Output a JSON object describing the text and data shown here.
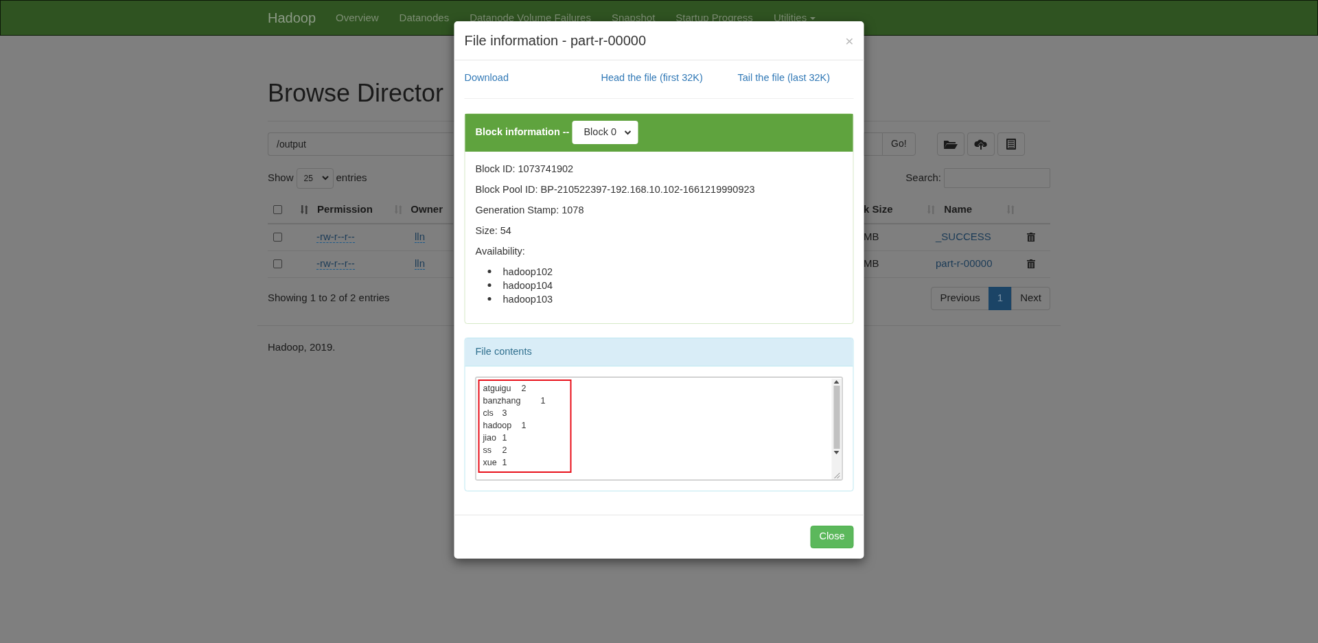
{
  "navbar": {
    "brand": "Hadoop",
    "items": [
      {
        "label": "Overview",
        "dropdown": false
      },
      {
        "label": "Datanodes",
        "dropdown": false
      },
      {
        "label": "Datanode Volume Failures",
        "dropdown": false
      },
      {
        "label": "Snapshot",
        "dropdown": false
      },
      {
        "label": "Startup Progress",
        "dropdown": false
      },
      {
        "label": "Utilities",
        "dropdown": true
      }
    ]
  },
  "browser": {
    "title": "Browse Director",
    "path": "/output",
    "go_label": "Go!",
    "show_label": "Show",
    "page_size": "25",
    "entries_label": "entries",
    "search_label": "Search:",
    "select_all_checked": false,
    "columns_left": [
      "Permission",
      "Owner"
    ],
    "columns_right": [
      "k Size",
      "Name"
    ],
    "rows": [
      {
        "checked": false,
        "permission": "-rw-r--r--",
        "owner": "lln",
        "size": "MB",
        "name": "_SUCCESS"
      },
      {
        "checked": false,
        "permission": "-rw-r--r--",
        "owner": "lln",
        "size": "MB",
        "name": "part-r-00000"
      }
    ],
    "info": "Showing 1 to 2 of 2 entries",
    "pagination": [
      {
        "label": "Previous",
        "selected": false
      },
      {
        "label": "1",
        "selected": true
      },
      {
        "label": "Next",
        "selected": false
      }
    ],
    "footer": "Hadoop, 2019."
  },
  "modal": {
    "title": "File information - part-r-00000",
    "close": "×",
    "links": [
      "Download",
      "Head the file (first 32K)",
      "Tail the file (last 32K)"
    ],
    "block_panel": {
      "label": "Block information --",
      "block_select": "Block 0",
      "details": [
        "Block ID: 1073741902",
        "Block Pool ID: BP-210522397-192.168.10.102-1661219990923",
        "Generation Stamp: 1078",
        "Size: 54",
        "Availability:"
      ],
      "availability": [
        "hadoop102",
        "hadoop104",
        "hadoop103"
      ]
    },
    "contents_panel": {
      "title": "File contents",
      "lines": [
        "atguigu\t2",
        "banzhang\t1",
        "cls\t3",
        "hadoop\t1",
        "jiao\t1",
        "ss\t2",
        "xue\t1"
      ]
    },
    "close_button": "Close"
  }
}
